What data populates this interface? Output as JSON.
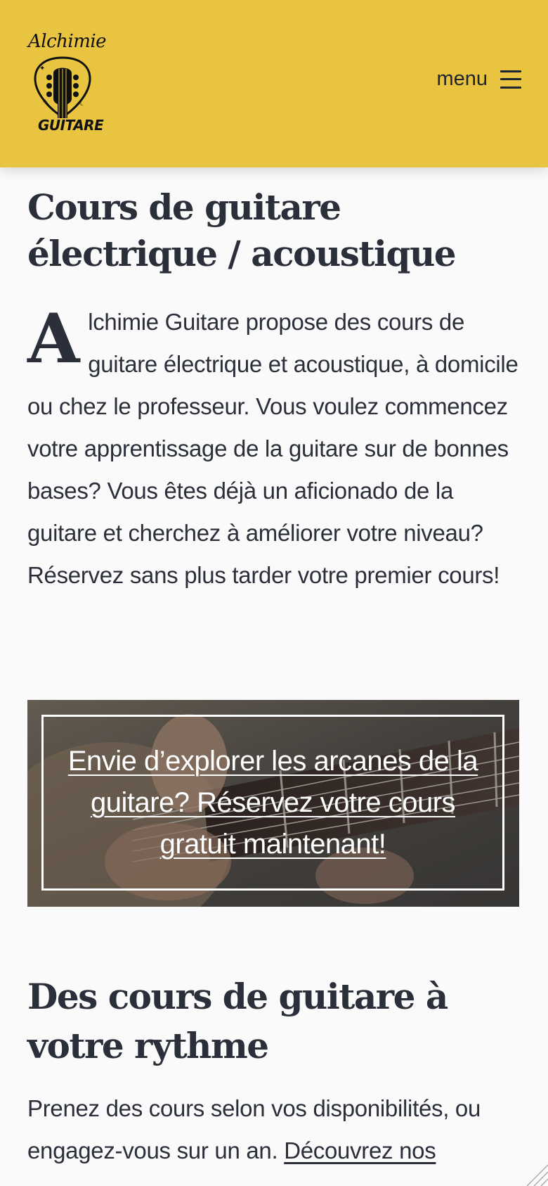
{
  "header": {
    "logo_top": "Alchimie",
    "logo_bottom": "GUITARE",
    "menu_label": "menu",
    "background_color": "#e8c440"
  },
  "main": {
    "title": "Cours de guitare électrique / acoustique",
    "intro_dropcap": "A",
    "intro_rest": "lchimie Guitare propose des cours de guitare électrique et acoustique, à domicile ou chez le professeur. Vous voulez commencez votre apprentissage de la guitare sur de bonnes bases? Vous êtes déjà un aficionado de la guitare et cherchez à améliorer votre niveau? Réservez sans plus tarder votre premier cours!"
  },
  "cta": {
    "text": "Envie d’explorer les arcanes de la guitare? Réservez votre cours gratuit maintenant!"
  },
  "section2": {
    "title": "Des cours de guitare à votre rythme",
    "text": "Prenez des cours selon vos disponibilités, ou engagez-vous sur un an.",
    "link": "Découvrez nos"
  },
  "icons": {
    "menu": "hamburger-icon",
    "logo": "guitar-headstock-icon",
    "resize": "resize-grip-icon"
  }
}
